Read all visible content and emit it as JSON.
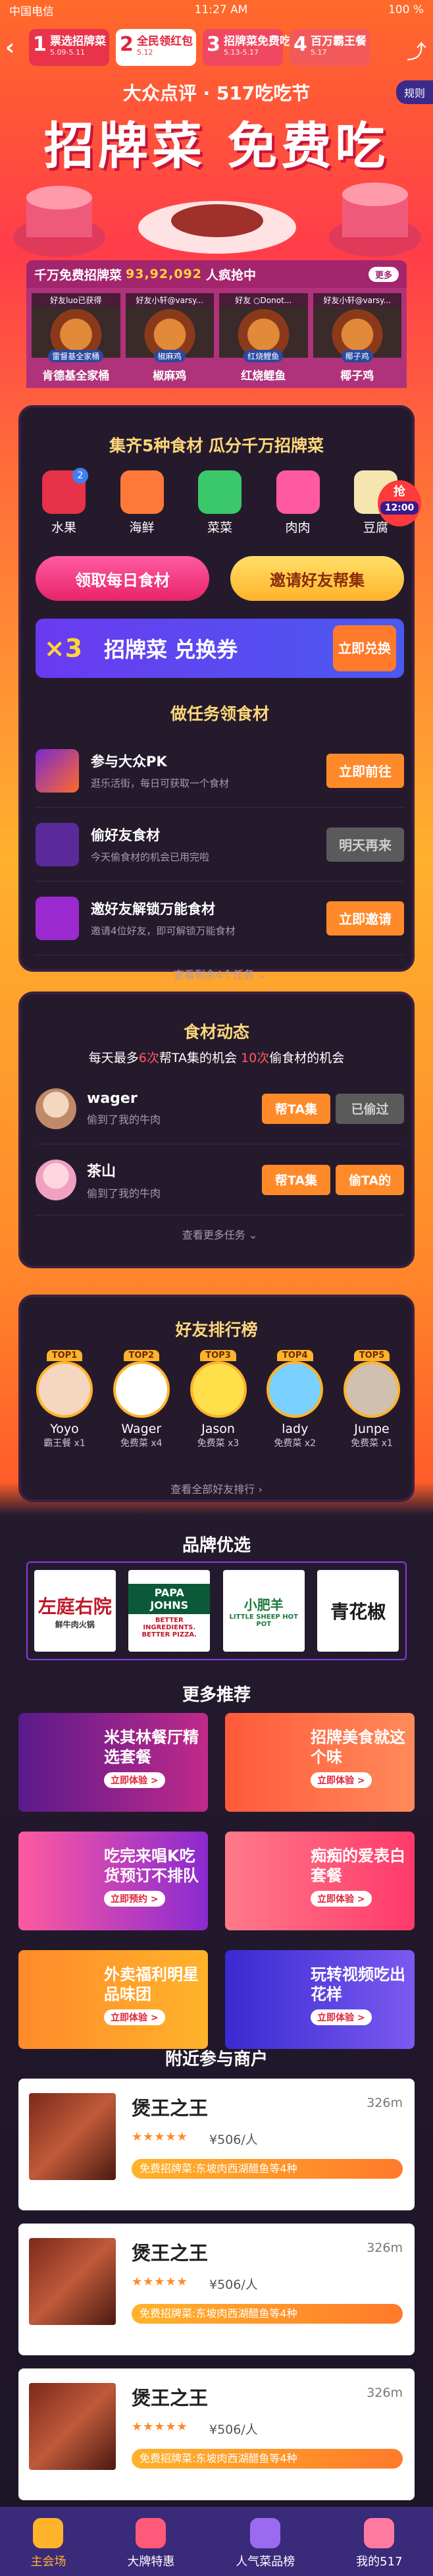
{
  "statusbar": {
    "carrier": "中国电信",
    "time": "11:27 AM",
    "battery": "100 %"
  },
  "steps": [
    {
      "num": "1",
      "title": "票选招牌菜",
      "date": "5.09-5.11"
    },
    {
      "num": "2",
      "title": "全民领红包",
      "date": "5.12"
    },
    {
      "num": "3",
      "title": "招牌菜免费吃",
      "date": "5.13-5.17"
    },
    {
      "num": "4",
      "title": "百万霸王餐",
      "date": "5.17"
    }
  ],
  "header": {
    "logo": "大众点评 · 517吃吃节",
    "title": "招牌菜 免费吃",
    "rules": "规则"
  },
  "counter": {
    "prefix": "千万免费招牌菜",
    "number": "93,92,092",
    "suffix": "人疯抢中",
    "more": "更多"
  },
  "winners": [
    {
      "who": "好友luo已获得",
      "tag": "雷督基全家桶",
      "dish": "肯德基全家桶"
    },
    {
      "who": "好友小轩@varsy...",
      "tag": "椒麻鸡",
      "dish": "椒麻鸡"
    },
    {
      "who": "好友 ○Donot...",
      "tag": "红烧鲤鱼",
      "dish": "红烧鲤鱼"
    },
    {
      "who": "好友小轩@varsy...",
      "tag": "椰子鸡",
      "dish": "椰子鸡"
    }
  ],
  "collect": {
    "title": "集齐5种食材  瓜分千万招牌菜",
    "ingredients": [
      {
        "label": "水果",
        "badge": "2",
        "color": "#e8324a"
      },
      {
        "label": "海鲜",
        "badge": "",
        "color": "#ff7a3a"
      },
      {
        "label": "菜菜",
        "badge": "",
        "color": "#3ac86a"
      },
      {
        "label": "肉肉",
        "badge": "",
        "color": "#ff5aa0"
      },
      {
        "label": "豆腐",
        "badge": "",
        "color": "#f5e6b0"
      }
    ],
    "grab": {
      "label": "抢",
      "time": "12:00"
    },
    "btn_daily": "领取每日食材",
    "btn_invite": "邀请好友帮集",
    "coupon": {
      "mult": "×3",
      "name": "招牌菜 兑换券",
      "go": "立即兑换"
    }
  },
  "tasks": {
    "title": "做任务领食材",
    "items": [
      {
        "name": "参与大众PK",
        "desc": "逛乐活街，每日可获取一个食材",
        "btn": "立即前往",
        "active": true
      },
      {
        "name": "偷好友食材",
        "desc": "今天偷食材的机会已用完啦",
        "btn": "明天再来",
        "active": false
      },
      {
        "name": "邀好友解锁万能食材",
        "desc": "邀请4位好友，即可解锁万能食材",
        "btn": "立即邀请",
        "active": true
      }
    ],
    "more": "查看剩余4个任务"
  },
  "feed": {
    "title": "食材动态",
    "sub_pre": "每天最多",
    "sub_n1": "6次",
    "sub_mid": "帮TA集的机会 ",
    "sub_n2": "10次",
    "sub_end": "偷食材的机会",
    "items": [
      {
        "name": "wager",
        "desc": "偷到了我的牛肉",
        "btn1": "帮TA集",
        "btn2": "已偷过",
        "btn2_active": false
      },
      {
        "name": "茶山",
        "desc": "偷到了我的牛肉",
        "btn1": "帮TA集",
        "btn2": "偷TA的",
        "btn2_active": true
      }
    ],
    "more": "查看更多任务"
  },
  "ranking": {
    "title": "好友排行榜",
    "items": [
      {
        "top": "TOP1",
        "name": "Yoyo",
        "stat": "霸王餐 x1"
      },
      {
        "top": "TOP2",
        "name": "Wager",
        "stat": "免费菜 x4"
      },
      {
        "top": "TOP3",
        "name": "Jason",
        "stat": "免费菜 x3"
      },
      {
        "top": "TOP4",
        "name": "lady",
        "stat": "免费菜 x2"
      },
      {
        "top": "TOP5",
        "name": "Junpe",
        "stat": "免费菜 x1"
      }
    ],
    "more": "查看全部好友排行"
  },
  "brands": {
    "title": "品牌优选",
    "items": [
      {
        "name": "左庭右院",
        "sub": "鲜牛肉火锅"
      },
      {
        "name": "PAPA JOHNS",
        "sub": "BETTER INGREDIENTS. BETTER PIZZA."
      },
      {
        "name": "小肥羊",
        "sub": "LITTLE SHEEP HOT POT"
      },
      {
        "name": "青花椒",
        "sub": ""
      }
    ]
  },
  "more": {
    "title": "更多推荐",
    "items": [
      {
        "title": "米其林餐厅精选套餐",
        "btn": "立即体验 >",
        "color": "#c02a8a"
      },
      {
        "title": "招牌美食就这个味",
        "btn": "立即体验 >",
        "color": "#ff5a3a"
      },
      {
        "title": "吃完来唱K吃货预订不排队",
        "btn": "立即预约 >",
        "color": "#8a2ad0"
      },
      {
        "title": "痴痴的爱表白套餐",
        "btn": "立即体验 >",
        "color": "#ff3a6a"
      },
      {
        "title": "外卖福利明星品味团",
        "btn": "立即体验 >",
        "color": "#ff6a2a"
      },
      {
        "title": "玩转视频吃出花样",
        "btn": "立即体验 >",
        "color": "#4a3ae0"
      }
    ]
  },
  "merchants": {
    "title": "附近参与商户",
    "items": [
      {
        "name": "煲王之王",
        "dist": "326m",
        "stars": "★★★★★",
        "price": "¥506/人",
        "coupon": "免费招牌菜:东坡肉西湖醋鱼等4种"
      },
      {
        "name": "煲王之王",
        "dist": "326m",
        "stars": "★★★★★",
        "price": "¥506/人",
        "coupon": "免费招牌菜:东坡肉西湖醋鱼等4种"
      },
      {
        "name": "煲王之王",
        "dist": "326m",
        "stars": "★★★★★",
        "price": "¥506/人",
        "coupon": "免费招牌菜:东坡肉西湖醋鱼等4种"
      }
    ]
  },
  "tabbar": [
    {
      "label": "主会场",
      "selected": true
    },
    {
      "label": "大牌特惠",
      "selected": false
    },
    {
      "label": "人气菜品榜",
      "selected": false
    },
    {
      "label": "我的517",
      "selected": false
    }
  ]
}
